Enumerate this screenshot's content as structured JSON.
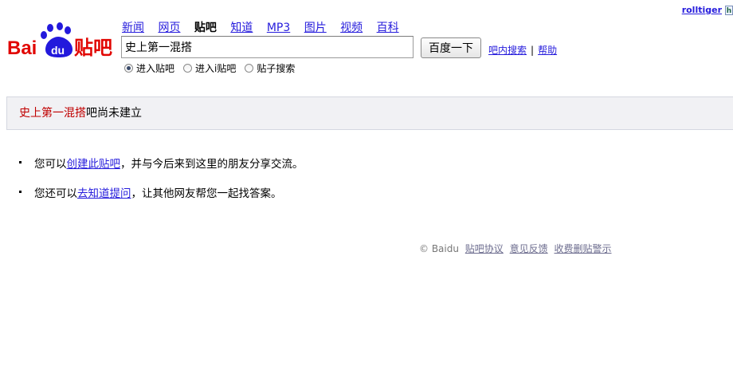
{
  "user": {
    "name": "rolltiger",
    "icon": "user-badge-icon"
  },
  "logo": {
    "text_baidu_left": "Bai",
    "text_du": "du",
    "text_tieba": "贴吧",
    "brand_red": "#e10602",
    "brand_blue": "#2319dc"
  },
  "nav": {
    "items": [
      "新闻",
      "网页",
      "贴吧",
      "知道",
      "MP3",
      "图片",
      "视频",
      "百科"
    ],
    "current_index": 2
  },
  "search": {
    "value": "史上第一混搭",
    "button_label": "百度一下",
    "link_inner_search": "吧内搜索",
    "separator": "|",
    "link_help": "帮助"
  },
  "radios": {
    "options": [
      "进入贴吧",
      "进入i贴吧",
      "贴子搜索"
    ],
    "selected_index": 0
  },
  "notice": {
    "bar_name": "史上第一混搭",
    "suffix": "吧尚未建立"
  },
  "bullets": {
    "line1_prefix": "您可以",
    "line1_link": "创建此贴吧",
    "line1_suffix": "，并与今后来到这里的朋友分享交流。",
    "line2_prefix": "您还可以",
    "line2_link": "去知道提问",
    "line2_suffix": "，让其他网友帮您一起找答案。"
  },
  "footer": {
    "copyright": "© Baidu",
    "links": [
      "贴吧协议",
      "意见反馈",
      "收费删贴警示"
    ]
  }
}
